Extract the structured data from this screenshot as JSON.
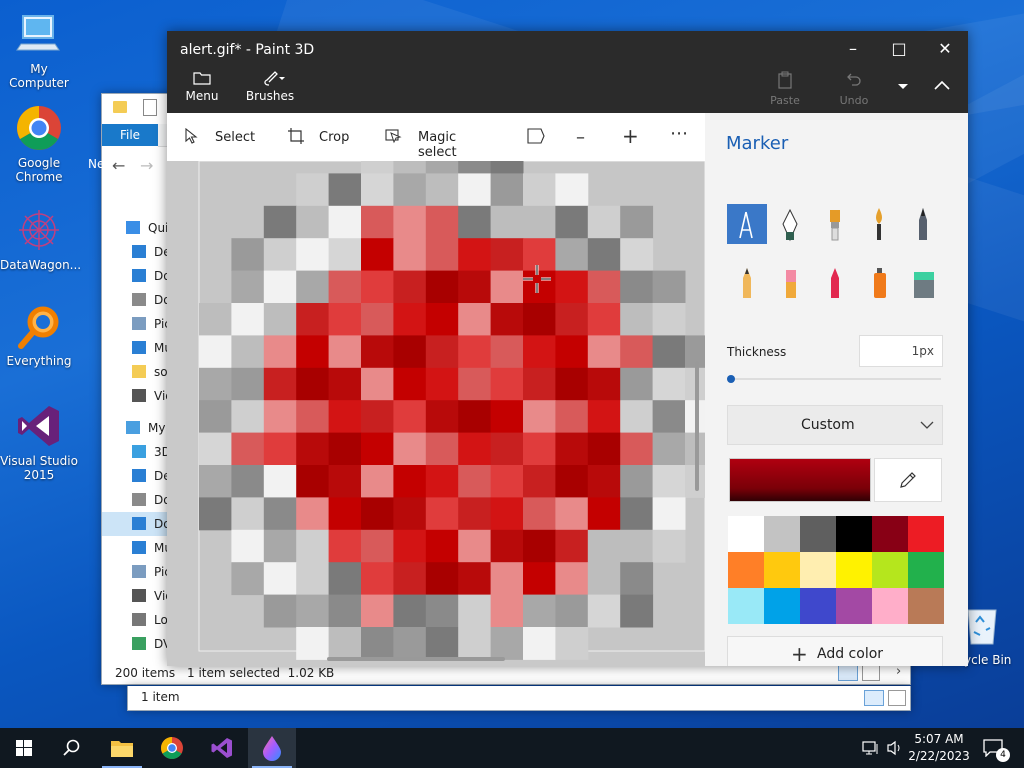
{
  "desktop": {
    "icons": [
      {
        "label": "My Computer",
        "icon": "computer-icon"
      },
      {
        "label": "Google Chrome",
        "icon": "chrome-icon"
      },
      {
        "label": "DataWagon...",
        "icon": "datawagon-icon"
      },
      {
        "label": "Everything",
        "icon": "search-icon"
      },
      {
        "label": "Visual Studio 2015",
        "icon": "visual-studio-icon"
      },
      {
        "label": "ycle Bin",
        "icon": "recycle-bin-icon"
      }
    ]
  },
  "explorer_back": {
    "ribbon_tab": "File",
    "status_count": "200 items",
    "status_selected": "1 item selected  1.02 KB",
    "sidebar": [
      {
        "label": "Quic",
        "icon": "star-icon"
      },
      {
        "label": "De",
        "icon": "desktop-icon"
      },
      {
        "label": "Do",
        "icon": "download-icon"
      },
      {
        "label": "Do",
        "icon": "document-icon"
      },
      {
        "label": "Pic",
        "icon": "picture-icon"
      },
      {
        "label": "Mu",
        "icon": "music-icon"
      },
      {
        "label": "so",
        "icon": "folder-icon"
      },
      {
        "label": "Vid",
        "icon": "video-icon"
      },
      {
        "label": "My",
        "icon": "computer-icon"
      },
      {
        "label": "3D",
        "icon": "cube-icon"
      },
      {
        "label": "De",
        "icon": "desktop-icon"
      },
      {
        "label": "Do",
        "icon": "document-icon"
      },
      {
        "label": "Do",
        "icon": "download-icon"
      },
      {
        "label": "Mu",
        "icon": "music-icon"
      },
      {
        "label": "Pic",
        "icon": "picture-icon"
      },
      {
        "label": "Vid",
        "icon": "video-icon"
      },
      {
        "label": "Lo",
        "icon": "drive-icon"
      },
      {
        "label": "DV",
        "icon": "dvd-icon"
      }
    ],
    "ne_text": "Ne"
  },
  "explorer_front": {
    "status": "1 item"
  },
  "paint": {
    "title": "alert.gif* - Paint 3D",
    "menu_label": "Menu",
    "brushes_label": "Brushes",
    "paste_label": "Paste",
    "undo_label": "Undo",
    "tools": {
      "select": "Select",
      "crop": "Crop",
      "magic_select": "Magic select"
    },
    "panel": {
      "title": "Marker",
      "thickness_label": "Thickness",
      "thickness_value": "1px",
      "thickness_level": 0.0,
      "custom_label": "Custom",
      "add_color": "Add color",
      "selected_color": "#b00010",
      "palette": [
        "#ffffff",
        "#c3c3c3",
        "#5f5f5f",
        "#000000",
        "#880015",
        "#ed1c24",
        "#ff7f27",
        "#ffc90e",
        "#ffeeb0",
        "#fff200",
        "#b5e61d",
        "#22b14c",
        "#99e9f7",
        "#00a2e8",
        "#3f48cc",
        "#a349a4",
        "#ffaec9",
        "#b97a57"
      ]
    }
  },
  "taskbar": {
    "time": "5:07 AM",
    "date": "2/22/2023",
    "notif_count": "4"
  }
}
